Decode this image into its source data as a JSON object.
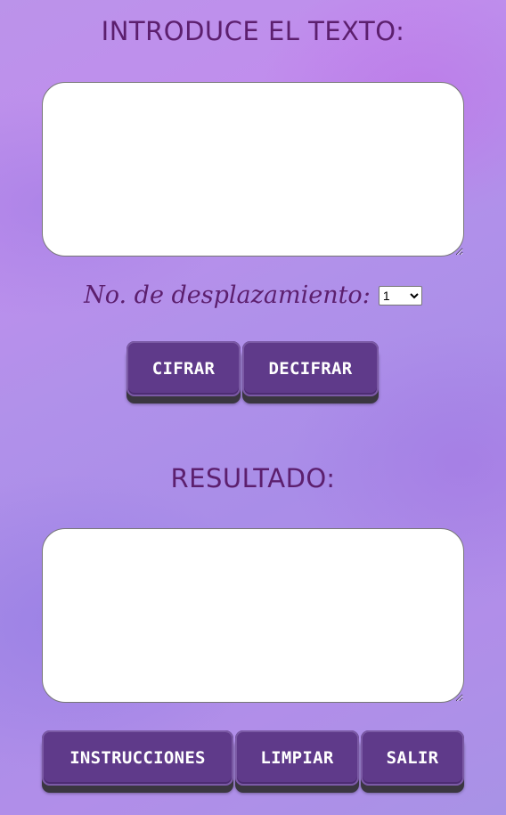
{
  "input_section": {
    "title": "INTRODUCE EL TEXTO:",
    "textarea_value": ""
  },
  "shift": {
    "label": "No. de desplazamiento:",
    "selected_value": "1"
  },
  "actions": {
    "cifrar_label": "CIFRAR",
    "decifrar_label": "DECIFRAR"
  },
  "result_section": {
    "title": "RESULTADO:",
    "textarea_value": ""
  },
  "footer": {
    "instrucciones_label": "INSTRUCCIONES",
    "limpiar_label": "LIMPIAR",
    "salir_label": "SALIR"
  },
  "colors": {
    "heading": "#5c1f6e",
    "button_face": "#5f3a8a",
    "button_base": "#3a3640",
    "background_start": "#bb93ea",
    "background_end": "#a892e6"
  }
}
